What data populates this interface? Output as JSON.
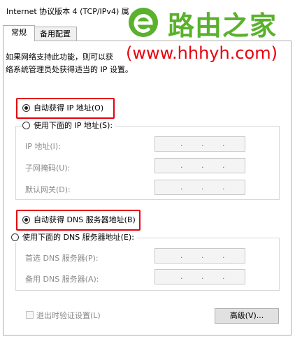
{
  "window": {
    "title": "Internet 协议版本 4 (TCP/IPv4) 属"
  },
  "tabs": [
    {
      "label": "常规"
    },
    {
      "label": "备用配置"
    }
  ],
  "description": {
    "line1": "如果网络支持此功能，则可以获",
    "line2": "络系统管理员处获得适当的 IP 设置。"
  },
  "ip": {
    "auto_label": "自动获得 IP 地址(O)",
    "manual_label": "使用下面的 IP 地址(S):",
    "fields": [
      {
        "label": "IP 地址(I):",
        "value": ". . ."
      },
      {
        "label": "子网掩码(U):",
        "value": ". . ."
      },
      {
        "label": "默认网关(D):",
        "value": ". . ."
      }
    ]
  },
  "dns": {
    "auto_label": "自动获得 DNS 服务器地址(B)",
    "manual_label": "使用下面的 DNS 服务器地址(E):",
    "fields": [
      {
        "label": "首选 DNS 服务器(P):",
        "value": ". . ."
      },
      {
        "label": "备用 DNS 服务器(A):",
        "value": ". . ."
      }
    ]
  },
  "validate_label": "退出时验证设置(L)",
  "advanced_label": "高级(V)...",
  "watermark": {
    "brand": "路由之家",
    "url": "(www.hhhyh.com)"
  },
  "colors": {
    "highlight": "#e8000b",
    "watermark_green": "#59b12c"
  }
}
